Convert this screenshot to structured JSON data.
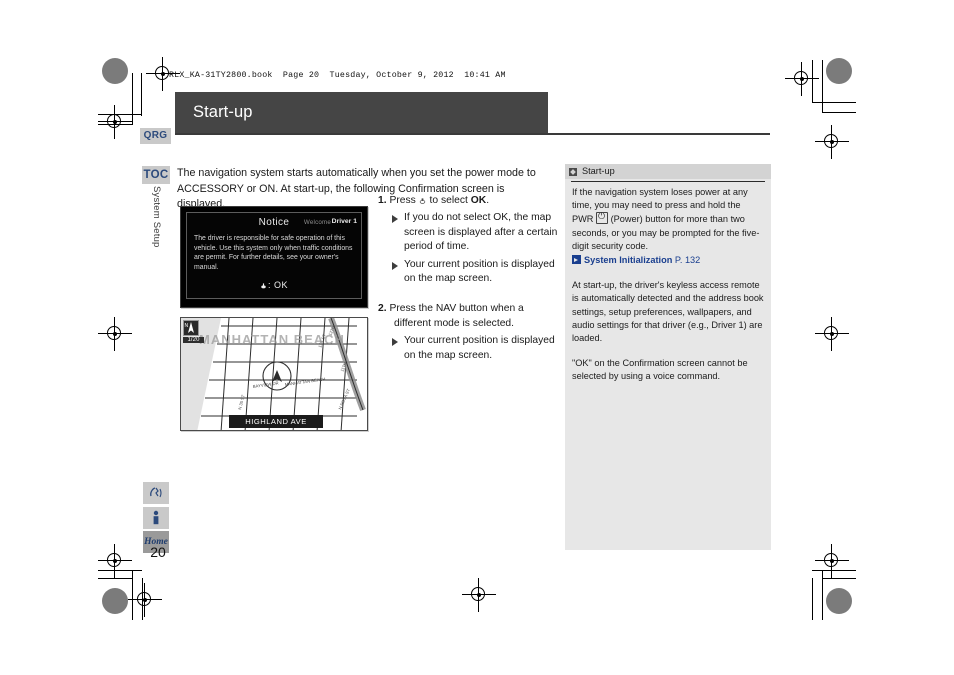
{
  "document": {
    "file_info": "RLX_KA-31TY2800.book  Page 20  Tuesday, October 9, 2012  10:41 AM",
    "title": "Start-up",
    "page_number": "20"
  },
  "tabs": {
    "qrg": "QRG",
    "toc": "TOC",
    "section_label": "System Setup"
  },
  "side_buttons": {
    "voice_icon": "voice-command-icon",
    "info_icon": "information-icon",
    "home_label": "Home"
  },
  "main": {
    "intro": "The navigation system starts automatically when you set the power mode to ACCESSORY or ON. At start-up, the following Confirmation screen is displayed."
  },
  "notice_screen": {
    "heading": "Notice",
    "welcome": "Welcome",
    "driver": "Driver 1",
    "body": "The driver is responsible for safe operation of this vehicle. Use this system only when traffic conditions are permit. For further details, see your owner's manual.",
    "ok_label": ": OK",
    "ok_icon": "joystick-icon"
  },
  "map_screen": {
    "scale": "1/20",
    "north_icon": "north-arrow-icon",
    "city_label": "MANHATTAN BEACH",
    "street_bar": "HIGHLAND AVE"
  },
  "steps": [
    {
      "number": "1.",
      "text_before": "Press",
      "icon": "joystick-icon",
      "text_middle": "to select",
      "emphasis": "OK",
      "text_after": ".",
      "bullets": [
        "If you do not select OK, the map screen is displayed after a certain period of time.",
        "Your current position is displayed on the map screen."
      ],
      "bullet_bold_word": "OK"
    },
    {
      "number": "2.",
      "text": "Press the NAV button when a different mode is selected.",
      "bullets": [
        "Your current position is displayed on the map screen."
      ]
    }
  ],
  "info_panel": {
    "header": "Start-up",
    "header_icon": "note-icon",
    "paragraph_1_a": "If the navigation system loses power at any time, you may need to press and hold the PWR",
    "paragraph_1_b": "(Power) button for more than two seconds, or you may be prompted for the five-digit security code.",
    "pwr_icon": "power-button-icon",
    "xref_icon": "cross-reference-icon",
    "xref_label": "System Initialization",
    "xref_page": "P. 132",
    "paragraph_2": "At start-up, the driver's keyless access remote is automatically detected and the address book settings, setup preferences, wallpapers, and audio settings for that driver (e.g., Driver 1) are loaded.",
    "paragraph_3": "\"OK\" on the Confirmation screen cannot be selected by using a voice command."
  },
  "colors": {
    "title_bar": "#454545",
    "tab_text": "#2c4a7c",
    "panel_bg": "#e7e7e7",
    "xref_blue": "#1a3f8f"
  }
}
